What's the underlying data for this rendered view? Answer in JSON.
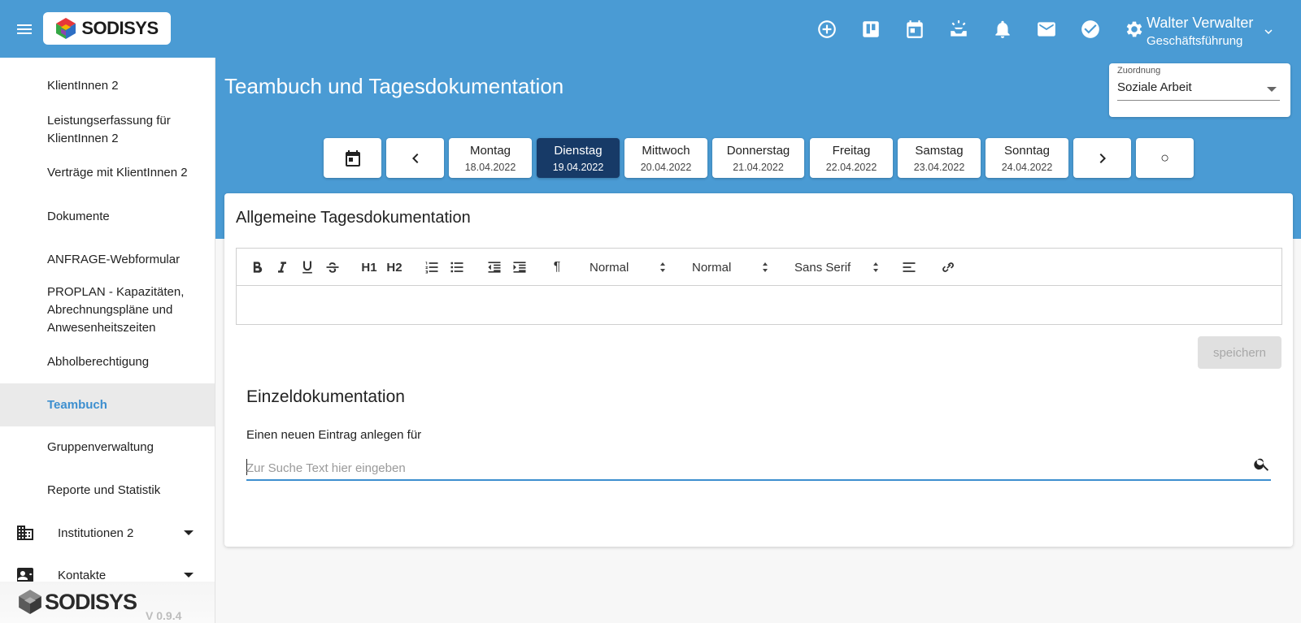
{
  "header": {
    "brand": "SODISYS",
    "user": {
      "name": "Walter Verwalter",
      "role": "Geschäftsführung"
    },
    "icons": [
      "add-circle-icon",
      "kanban-board-icon",
      "calendar-icon",
      "inbox-tray-icon",
      "bell-icon",
      "mail-icon",
      "check-circle-icon",
      "gear-icon"
    ]
  },
  "sidebar": {
    "items": [
      {
        "label": "KlientInnen 2"
      },
      {
        "label": "Leistungserfassung für KlientInnen 2"
      },
      {
        "label": "Verträge mit KlientInnen 2"
      },
      {
        "label": "Dokumente"
      },
      {
        "label": "ANFRAGE-Webformular"
      },
      {
        "label": "PROPLAN - Kapazitäten, Abrechnungspläne und Anwesenheitszeiten"
      },
      {
        "label": "Abholberechtigung"
      },
      {
        "label": "Teambuch",
        "active": true
      },
      {
        "label": "Gruppenverwaltung"
      },
      {
        "label": "Reporte und Statistik"
      }
    ],
    "groups": [
      {
        "label": "Institutionen 2",
        "icon": "building-icon"
      },
      {
        "label": "Kontakte",
        "icon": "contacts-icon"
      }
    ],
    "footer": {
      "brand": "SODISYS",
      "version": "V 0.9.4"
    }
  },
  "page": {
    "title": "Teambuch und Tagesdokumentation",
    "zuordnung": {
      "label": "Zuordnung",
      "value": "Soziale Arbeit"
    }
  },
  "days": [
    {
      "name": "Montag",
      "date": "18.04.2022"
    },
    {
      "name": "Dienstag",
      "date": "19.04.2022",
      "active": true
    },
    {
      "name": "Mittwoch",
      "date": "20.04.2022"
    },
    {
      "name": "Donnerstag",
      "date": "21.04.2022"
    },
    {
      "name": "Freitag",
      "date": "22.04.2022"
    },
    {
      "name": "Samstag",
      "date": "23.04.2022"
    },
    {
      "name": "Sonntag",
      "date": "24.04.2022"
    }
  ],
  "today_symbol": "○",
  "editor": {
    "title": "Allgemeine Tagesdokumentation",
    "h1": "H1",
    "h2": "H2",
    "para_symbol": "¶",
    "size_select": "Normal",
    "header_select": "Normal",
    "font_select": "Sans Serif",
    "save_label": "speichern"
  },
  "einzel": {
    "title": "Einzeldokumentation",
    "label": "Einen neuen Eintrag anlegen für",
    "search_placeholder": "Zur Suche Text hier eingeben"
  },
  "colors": {
    "primary": "#4a9bd4",
    "active_day": "#173a67",
    "active_nav": "#3d8fcf"
  }
}
